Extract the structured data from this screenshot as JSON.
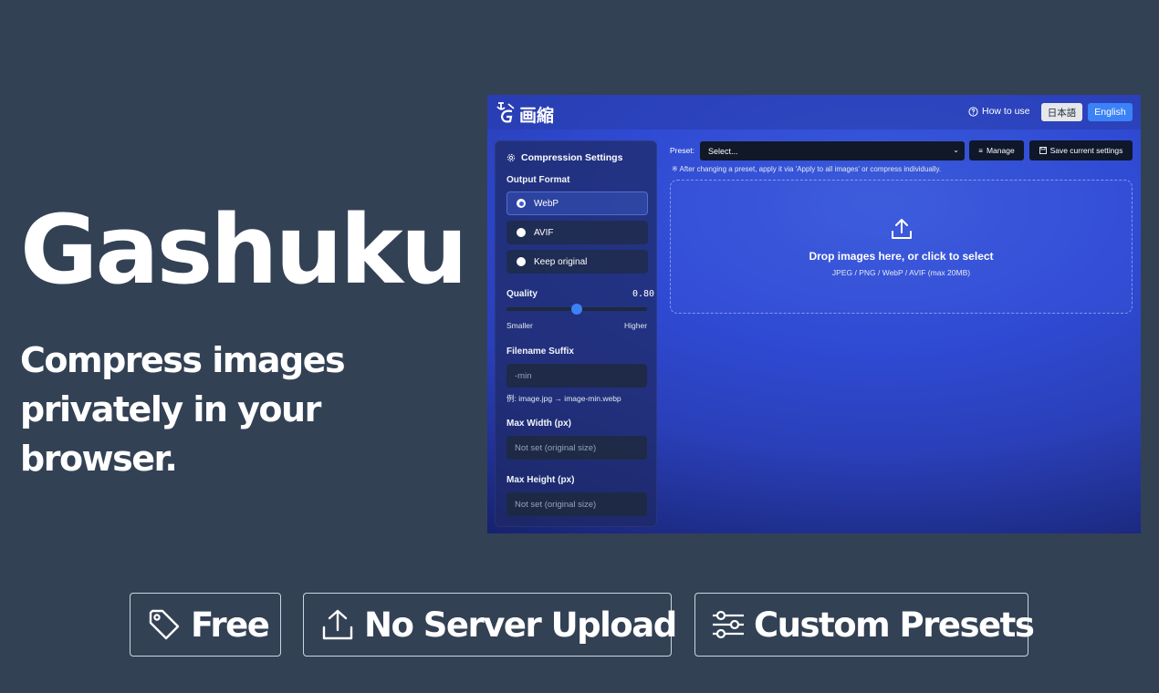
{
  "hero": {
    "title": "Gashuku",
    "subtitle_line1": "Compress images",
    "subtitle_line2": "privately in your browser."
  },
  "app": {
    "logo_text": "画縮",
    "header": {
      "how_to_use": "How to use",
      "lang_japanese": "日本語",
      "lang_english": "English"
    },
    "settings": {
      "title": "Compression Settings",
      "output_format_label": "Output Format",
      "formats": [
        {
          "label": "WebP",
          "selected": true
        },
        {
          "label": "AVIF",
          "selected": false
        },
        {
          "label": "Keep original",
          "selected": false
        }
      ],
      "quality_label": "Quality",
      "quality_value": "0.80",
      "quality_min_label": "Smaller",
      "quality_max_label": "Higher",
      "suffix_label": "Filename Suffix",
      "suffix_placeholder": "-min",
      "suffix_example": "例: image.jpg → image-min.webp",
      "max_width_label": "Max Width (px)",
      "max_width_placeholder": "Not set (original size)",
      "max_height_label": "Max Height (px)",
      "max_height_placeholder": "Not set (original size)"
    },
    "preset": {
      "label": "Preset:",
      "selected": "Select...",
      "manage_label": "Manage",
      "save_label": "Save current settings",
      "note": "※ After changing a preset, apply it via 'Apply to all images' or compress individually."
    },
    "dropzone": {
      "main": "Drop images here, or click to select",
      "sub": "JPEG / PNG / WebP / AVIF (max 20MB)"
    }
  },
  "features": [
    {
      "label": "Free",
      "icon": "tag-icon"
    },
    {
      "label": "No Server Upload",
      "icon": "upload-icon"
    },
    {
      "label": "Custom Presets",
      "icon": "sliders-icon"
    }
  ],
  "colors": {
    "background": "#334155",
    "accent": "#3b82f6",
    "app_gradient": "#2f4ad3"
  }
}
